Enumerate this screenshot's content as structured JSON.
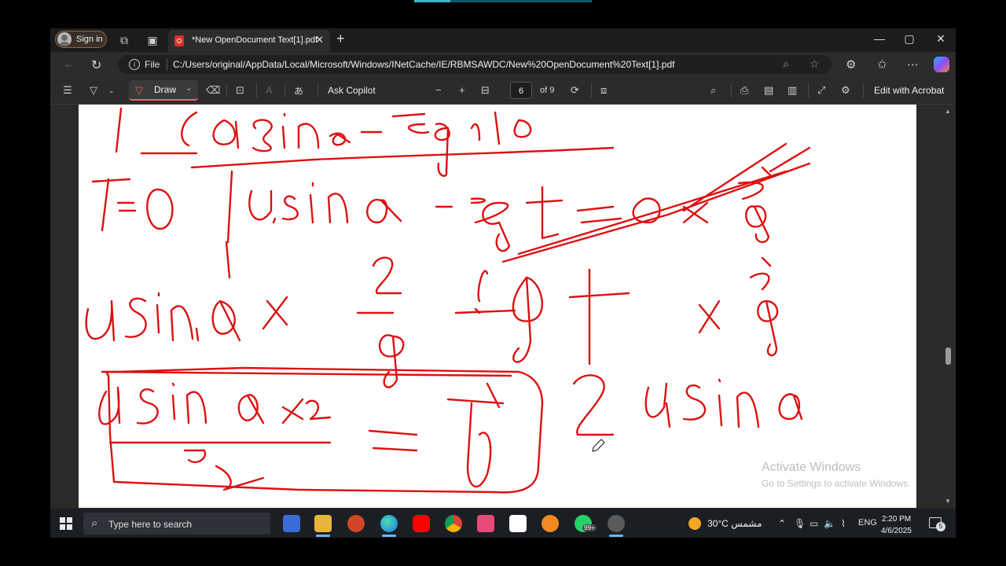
{
  "browser": {
    "signin_label": "Sign in",
    "tab_title": "*New OpenDocument Text[1].pdf",
    "tab_close": "✕",
    "new_tab": "+",
    "window_controls": [
      "—",
      "▢",
      "✕"
    ],
    "address_prefix": "File",
    "url": "C:/Users/original/AppData/Local/Microsoft/Windows/INetCache/IE/RBMSAWDC/New%20OpenDocument%20Text[1].pdf"
  },
  "pdf_toolbar": {
    "draw_label": "Draw",
    "ask_copilot": "Ask Copilot",
    "page_number": "6",
    "page_of": "of 9",
    "edit_with_acrobat": "Edit with Acrobat"
  },
  "document": {
    "ink_color": "#dd1111",
    "watermark_title": "Activate Windows",
    "watermark_sub": "Go to Settings to activate Windows."
  },
  "taskbar": {
    "search_placeholder": "Type here to search",
    "whatsapp_badge": "99+",
    "weather": "30°C  مشمس",
    "language": "ENG",
    "time": "2:20 PM",
    "date": "4/6/2025",
    "notification_count": "5"
  },
  "icons": [
    "sign-in-avatar-icon",
    "workspaces-icon",
    "tab-actions-icon",
    "pdf-icon",
    "back-icon",
    "refresh-icon",
    "info-icon",
    "zoom-icon",
    "favorite-star-icon",
    "extensions-icon",
    "favorites-icon",
    "more-icon",
    "copilot-icon",
    "contents-icon",
    "highlight-icon",
    "draw-icon",
    "eraser-icon",
    "text-icon",
    "read-aloud-icon",
    "translate-icon",
    "zoom-out-icon",
    "zoom-in-icon",
    "fit-page-icon",
    "rotate-icon",
    "page-view-icon",
    "search-icon",
    "print-icon",
    "save-icon",
    "save-as-icon",
    "fullscreen-icon",
    "settings-icon",
    "windows-start-icon",
    "store-icon",
    "file-explorer-icon",
    "powerpoint-icon",
    "edge-icon",
    "youtube-icon",
    "chrome-icon",
    "app-icon",
    "capcut-icon",
    "app-icon-2",
    "whatsapp-icon",
    "obs-icon",
    "weather-icon",
    "pen-cursor-icon"
  ]
}
